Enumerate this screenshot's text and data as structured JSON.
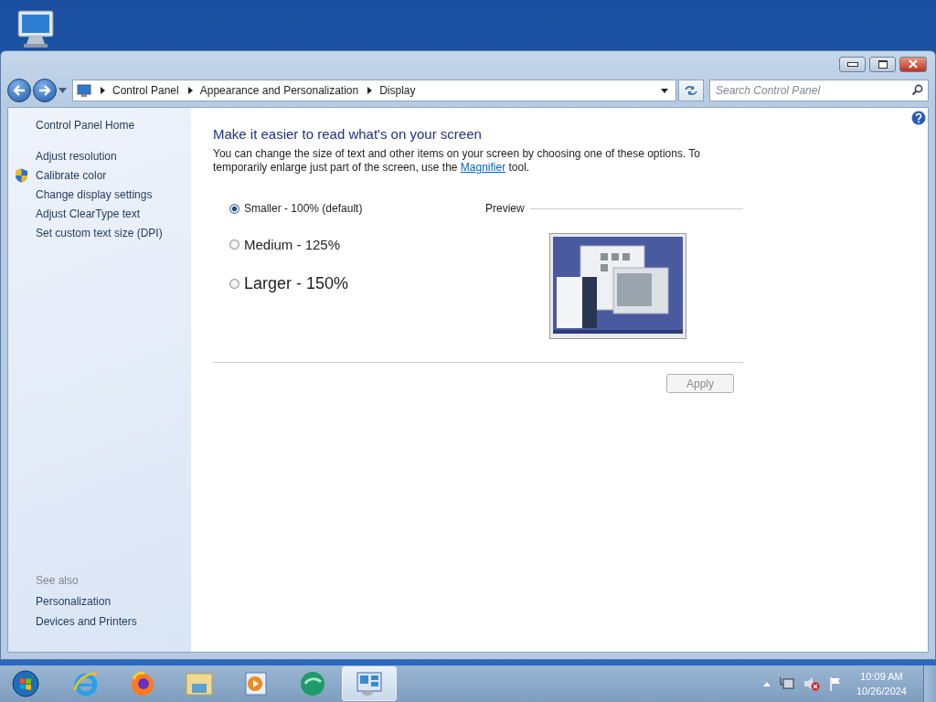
{
  "address_bar": {
    "breadcrumbs": [
      "Control Panel",
      "Appearance and Personalization",
      "Display"
    ]
  },
  "search": {
    "placeholder": "Search Control Panel"
  },
  "sidebar": {
    "home": "Control Panel Home",
    "tasks": [
      {
        "label": "Adjust resolution",
        "shield": false
      },
      {
        "label": "Calibrate color",
        "shield": true
      },
      {
        "label": "Change display settings",
        "shield": false
      },
      {
        "label": "Adjust ClearType text",
        "shield": false
      },
      {
        "label": "Set custom text size (DPI)",
        "shield": false
      }
    ],
    "see_also": {
      "heading": "See also",
      "links": [
        "Personalization",
        "Devices and Printers"
      ]
    }
  },
  "main": {
    "title": "Make it easier to read what's on your screen",
    "description": "You can change the size of text and other items on your screen by choosing one of these options. To temporarily enlarge just part of the screen, use the ",
    "link": "Magnifier",
    "description_end": " tool.",
    "options": [
      {
        "label": "Smaller - 100% (default)",
        "selected": true
      },
      {
        "label": "Medium - 125%",
        "selected": false
      },
      {
        "label": "Larger - 150%",
        "selected": false
      }
    ],
    "preview": {
      "label": "Preview"
    },
    "apply": {
      "label": "Apply",
      "disabled": true
    }
  },
  "taskbar": {
    "apps": [
      {
        "kind": "browser-e",
        "selected": false
      },
      {
        "kind": "browser-fox",
        "selected": false
      },
      {
        "kind": "folder",
        "selected": false
      },
      {
        "kind": "media",
        "selected": false
      },
      {
        "kind": "green",
        "selected": false
      },
      {
        "kind": "control-panel",
        "selected": true
      }
    ],
    "time": "10:09 AM",
    "date": "10/26/2024"
  }
}
